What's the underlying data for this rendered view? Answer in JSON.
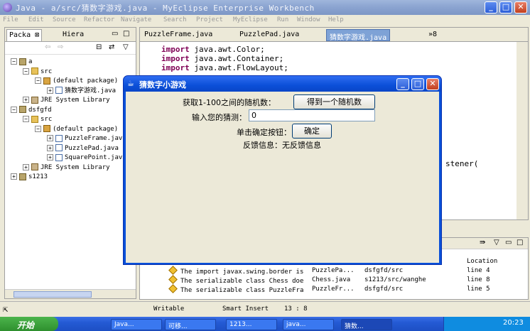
{
  "eclipse": {
    "title": "Java - a/src/猜数字游戏.java - MyEclipse Enterprise Workbench",
    "menu": [
      "File",
      "Edit",
      "Source",
      "Refactor",
      "Navigate",
      "Search",
      "Project",
      "MyEclipse",
      "Run",
      "Window",
      "Help"
    ]
  },
  "left_panel": {
    "tabs": [
      "Packa",
      "Hiera"
    ],
    "tree": [
      {
        "label": "a",
        "indent": 0,
        "exp": "−",
        "icon": "proj"
      },
      {
        "label": "src",
        "indent": 1,
        "exp": "−",
        "icon": "folder"
      },
      {
        "label": "(default package)",
        "indent": 2,
        "exp": "−",
        "icon": "pkg"
      },
      {
        "label": "猜数字游戏.java",
        "indent": 3,
        "exp": "+",
        "icon": "java"
      },
      {
        "label": "JRE System Library",
        "indent": 1,
        "exp": "+",
        "icon": "lib"
      },
      {
        "label": "dsfgfd",
        "indent": 0,
        "exp": "−",
        "icon": "proj"
      },
      {
        "label": "src",
        "indent": 1,
        "exp": "−",
        "icon": "folder"
      },
      {
        "label": "(default package)",
        "indent": 2,
        "exp": "−",
        "icon": "pkg"
      },
      {
        "label": "PuzzleFrame.java",
        "indent": 3,
        "exp": "+",
        "icon": "java"
      },
      {
        "label": "PuzzlePad.java",
        "indent": 3,
        "exp": "+",
        "icon": "java"
      },
      {
        "label": "SquarePoint.java",
        "indent": 3,
        "exp": "+",
        "icon": "java"
      },
      {
        "label": "JRE System Library",
        "indent": 1,
        "exp": "+",
        "icon": "lib"
      },
      {
        "label": "s1213",
        "indent": 0,
        "exp": "+",
        "icon": "proj"
      }
    ]
  },
  "editor": {
    "tabs": [
      "PuzzleFrame.java",
      "PuzzlePad.java",
      "猜数字游戏.java",
      "»8"
    ],
    "lines": [
      {
        "kw": "import",
        "rest": " java.awt.Color;"
      },
      {
        "kw": "import",
        "rest": " java.awt.Container;"
      },
      {
        "kw": "import",
        "rest": " java.awt.FlowLayout;"
      }
    ],
    "fragment": "stener("
  },
  "problems": {
    "location_header": "Location",
    "rows": [
      {
        "desc": "The import javax.swing.border is",
        "res": "PuzzlePa...",
        "path": "dsfgfd/src",
        "loc": "line 4"
      },
      {
        "desc": "The serializable class Chess doe",
        "res": "Chess.java",
        "path": "s1213/src/wanghe",
        "loc": "line 8"
      },
      {
        "desc": "The serializable class PuzzleFra",
        "res": "PuzzleFr...",
        "path": "dsfgfd/src",
        "loc": "line 5"
      }
    ]
  },
  "status": {
    "mode": "Writable",
    "insert": "Smart Insert",
    "pos": "13 : 8"
  },
  "dialog": {
    "title": "猜数字小游戏",
    "label_get": "获取1-100之间的随机数：",
    "btn_get": "得到一个随机数",
    "label_input": "输入您的猜测：",
    "input_value": "0",
    "label_confirm": "单击确定按钮：",
    "btn_confirm": "确定",
    "feedback": "反馈信息：无反馈信息"
  },
  "taskbar": {
    "start": "开始",
    "tasks": [
      "Java...",
      "可移...",
      "1213...",
      "java...",
      "猜数..."
    ],
    "clock": "20:23"
  }
}
